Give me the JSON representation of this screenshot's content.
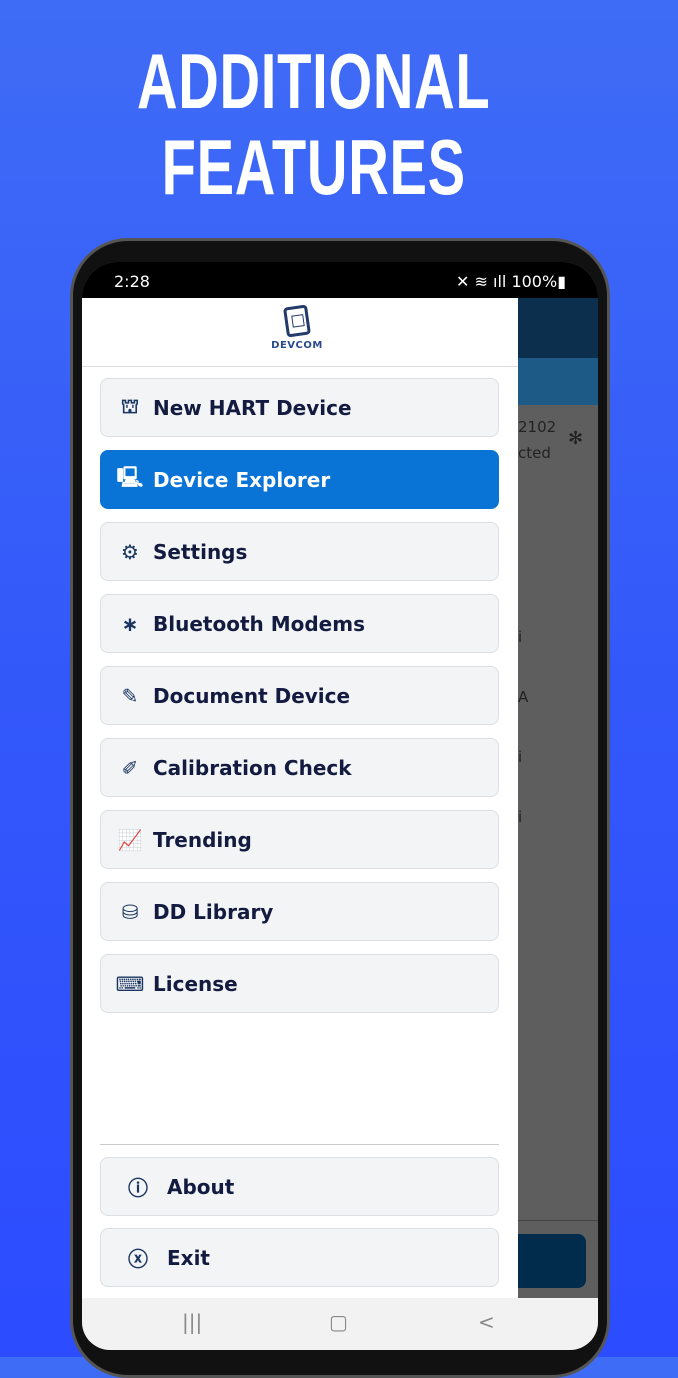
{
  "headline": [
    "ADDITIONAL",
    "FEATURES"
  ],
  "status": {
    "time": "2:28",
    "battery": "100%"
  },
  "app": {
    "logo_text": "DEVCOM",
    "background_text": [
      "2102",
      "cted",
      "i",
      "A",
      "i",
      "i"
    ]
  },
  "menu": [
    {
      "label": "New HART Device",
      "icon": "hart-device-icon",
      "glyph": "⛫"
    },
    {
      "label": "Device Explorer",
      "icon": "device-explorer-icon",
      "glyph": "🖳",
      "active": true
    },
    {
      "label": "Settings",
      "icon": "gear-icon",
      "glyph": "⚙"
    },
    {
      "label": "Bluetooth Modems",
      "icon": "bluetooth-icon",
      "glyph": "∗"
    },
    {
      "label": "Document Device",
      "icon": "document-edit-icon",
      "glyph": "✎"
    },
    {
      "label": "Calibration Check",
      "icon": "calibration-icon",
      "glyph": "✐"
    },
    {
      "label": "Trending",
      "icon": "trending-chart-icon",
      "glyph": "📈"
    },
    {
      "label": "DD Library",
      "icon": "dd-library-icon",
      "glyph": "⛁"
    },
    {
      "label": "License",
      "icon": "license-key-icon",
      "glyph": "⌨"
    }
  ],
  "footer": [
    {
      "label": "About",
      "icon": "info-icon",
      "glyph": "ⓘ"
    },
    {
      "label": "Exit",
      "icon": "close-circle-icon",
      "glyph": "ⓧ"
    }
  ],
  "navbar": {
    "recent": "|||",
    "home": "▢",
    "back": "<"
  },
  "colors": {
    "active": "#0a74d6",
    "background": "#3358fa"
  }
}
